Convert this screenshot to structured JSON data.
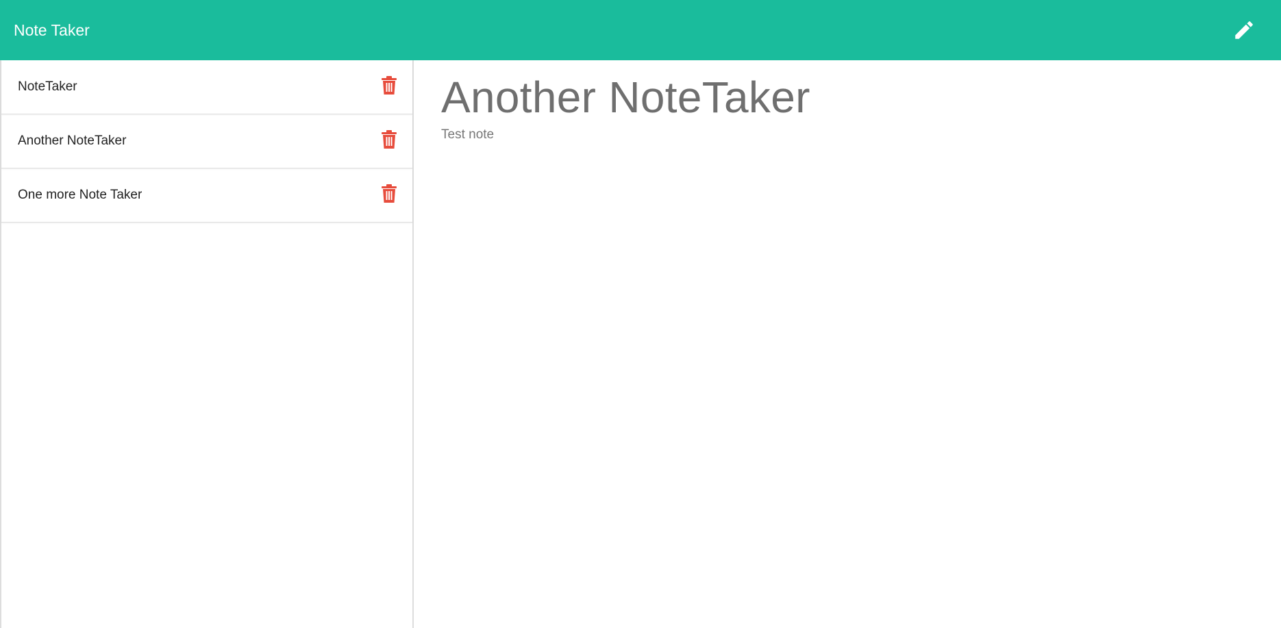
{
  "app": {
    "brand": "Note Taker",
    "new_note_icon": "pencil-icon",
    "accent_color": "#1abc9c",
    "delete_color": "#e74c3c"
  },
  "sidebar": {
    "notes": [
      {
        "title": "NoteTaker",
        "delete_icon": "trash-icon"
      },
      {
        "title": "Another NoteTaker",
        "delete_icon": "trash-icon"
      },
      {
        "title": "One more Note Taker",
        "delete_icon": "trash-icon"
      }
    ]
  },
  "editor": {
    "title": "Another NoteTaker",
    "text": "Test note"
  }
}
